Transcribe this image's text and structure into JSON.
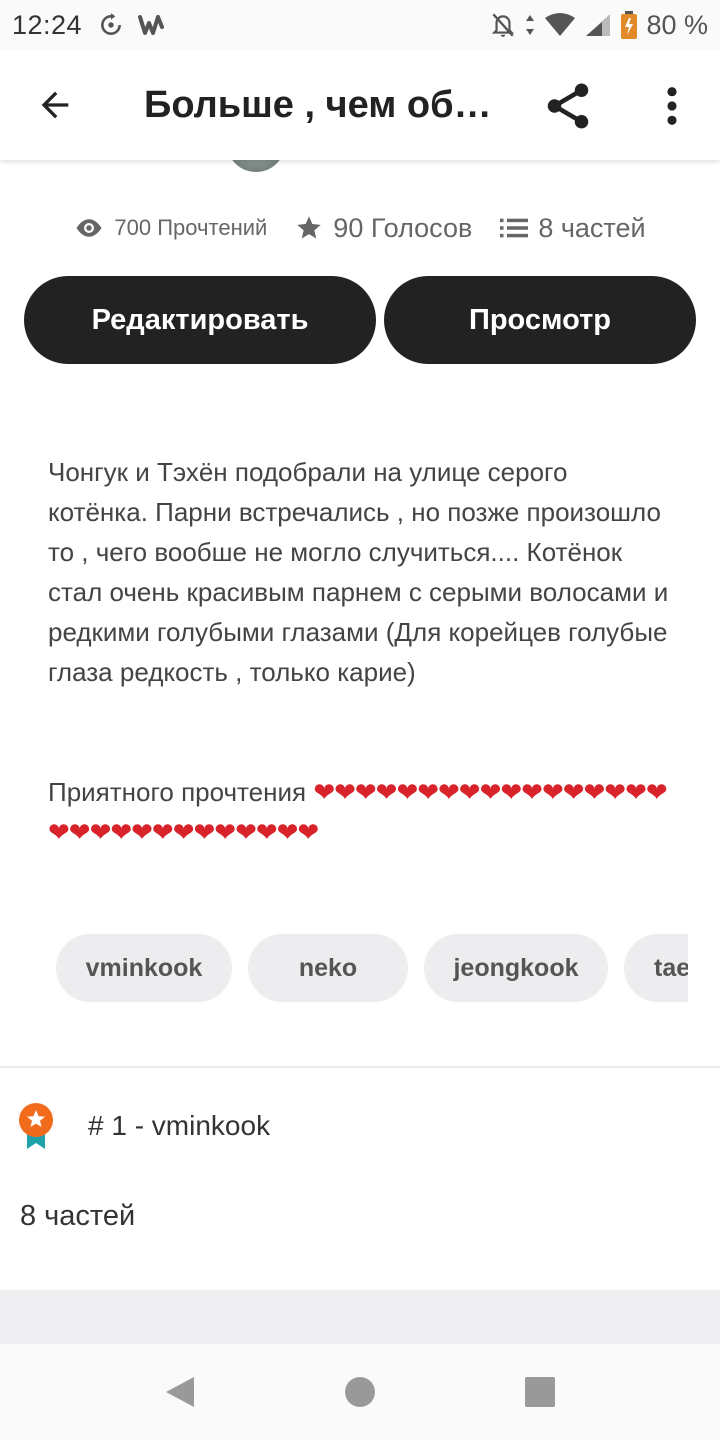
{
  "status_bar": {
    "time": "12:24",
    "battery": "80 %"
  },
  "app_bar": {
    "title": "Больше , чем обычный кот"
  },
  "stats": {
    "reads": "700 Прочтений",
    "votes": "90 Голосов",
    "parts": "8 частей"
  },
  "buttons": {
    "edit": "Редактировать",
    "preview": "Просмотр"
  },
  "description": "Чонгук и Тэхён подобрали на улице серого котёнка. Парни встречались , но позже произошло то , чего вообше не могло случиться.... Котёнок стал очень красивым парнем с серыми волосами и редкими голубыми глазами (Для корейцев голубые глаза редкость , только карие)",
  "greeting": {
    "text": "Приятного прочтения ",
    "hearts": "❤❤❤❤❤❤❤❤❤❤❤❤❤❤❤❤❤❤❤❤❤❤❤❤❤❤❤❤❤❤"
  },
  "tags": [
    "vminkook",
    "neko",
    "jeongkook",
    "taekook"
  ],
  "ranking": {
    "text": "# 1 - vminkook",
    "badge_color": "#f26b1d",
    "ribbon_color": "#1fa3a8"
  },
  "parts_count": "8 частей",
  "colors": {
    "button_bg": "#222222",
    "heart": "#d8232a",
    "tag_bg": "#ededef"
  }
}
